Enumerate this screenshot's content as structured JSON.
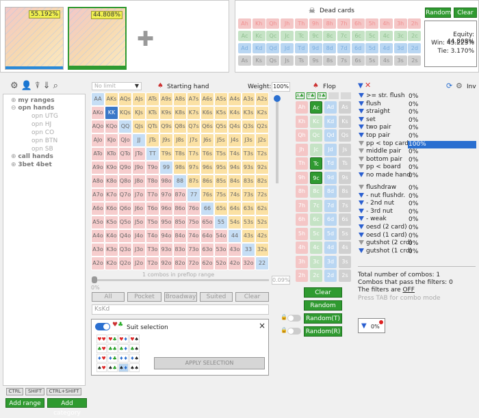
{
  "ranges": [
    {
      "pct": "55.192%",
      "accent": "#2a8ad8"
    },
    {
      "pct": "44.808%",
      "accent": "#2f9a30"
    }
  ],
  "dead_cards": {
    "title": "Dead cards",
    "random": "Random",
    "clear": "Clear",
    "rows": [
      [
        "Ah",
        "Kh",
        "Qh",
        "Jh",
        "Th",
        "9h",
        "8h",
        "7h",
        "6h",
        "5h",
        "4h",
        "3h",
        "2h"
      ],
      [
        "Ac",
        "Kc",
        "Qc",
        "Jc",
        "Tc",
        "9c",
        "8c",
        "7c",
        "6c",
        "5c",
        "4c",
        "3c",
        "2c"
      ],
      [
        "Ad",
        "Kd",
        "Qd",
        "Jd",
        "Td",
        "9d",
        "8d",
        "7d",
        "6d",
        "5d",
        "4d",
        "3d",
        "2d"
      ],
      [
        "As",
        "Ks",
        "Qs",
        "Js",
        "Ts",
        "9s",
        "8s",
        "7s",
        "6s",
        "5s",
        "4s",
        "3s",
        "2s"
      ]
    ]
  },
  "equity": {
    "equity": "Equity: 44.808%",
    "win": "Win: 43.223%",
    "tie": "Tie: 3.170%"
  },
  "limit": "No limit",
  "starting_hand": "Starting hand",
  "weight_label": "Weight:",
  "weight_value": "100%",
  "combos_info": "1 combos in preflop range",
  "slider_value": "0.09%",
  "slider_min": "0%",
  "filter_buttons": [
    "All",
    "Pocket",
    "Broadway",
    "Suited",
    "Clear"
  ],
  "hand_input": "KsKd",
  "suit_selection": {
    "title": "Suit selection",
    "apply": "APPLY SELECTION",
    "close": "×"
  },
  "tree": {
    "my_ranges": "my ranges",
    "opn_hands": "opn hands",
    "utg": "opn UTG",
    "hj": "opn HJ",
    "co": "opn CO",
    "btn": "opn BTN",
    "sb": "opn SB",
    "call_hands": "call hands",
    "bet3": "3bet 4bet"
  },
  "modifier_keys": [
    "CTRL",
    "SHIFT",
    "CTRL+SHIFT"
  ],
  "add_range": "Add range",
  "add_category": "Add category",
  "flop": {
    "title": "Flop",
    "chips": [
      "A♣",
      "T♣",
      "9♣"
    ],
    "cards": [
      [
        "Ah",
        "Ac",
        "Ad",
        "As"
      ],
      [
        "Kh",
        "Kc",
        "Kd",
        "Ks"
      ],
      [
        "Qh",
        "Qc",
        "Qd",
        "Qs"
      ],
      [
        "Jh",
        "Jc",
        "Jd",
        "Js"
      ],
      [
        "Th",
        "Tc",
        "Td",
        "Ts"
      ],
      [
        "9h",
        "9c",
        "9d",
        "9s"
      ],
      [
        "8h",
        "8c",
        "8d",
        "8s"
      ],
      [
        "7h",
        "7c",
        "7d",
        "7s"
      ],
      [
        "6h",
        "6c",
        "6d",
        "6s"
      ],
      [
        "5h",
        "5c",
        "5d",
        "5s"
      ],
      [
        "4h",
        "4c",
        "4d",
        "4s"
      ],
      [
        "3h",
        "3c",
        "3d",
        "3s"
      ],
      [
        "2h",
        "2c",
        "2d",
        "2s"
      ]
    ],
    "clear": "Clear",
    "random": "Random",
    "random_t": "Random(T)",
    "random_r": "Random(R)"
  },
  "inv": "Inv",
  "filters": [
    {
      "label": ">= str. flush",
      "value": "0%",
      "on": true
    },
    {
      "label": "flush",
      "value": "0%",
      "on": true
    },
    {
      "label": "straight",
      "value": "0%",
      "on": true
    },
    {
      "label": "set",
      "value": "0%",
      "on": true
    },
    {
      "label": "two pair",
      "value": "0%",
      "on": true
    },
    {
      "label": "top pair",
      "value": "0%",
      "on": true
    },
    {
      "label": "pp < top card",
      "value": "100%",
      "on": false,
      "hl": true
    },
    {
      "label": "middle pair",
      "value": "0%",
      "on": false
    },
    {
      "label": "bottom pair",
      "value": "0%",
      "on": false
    },
    {
      "label": "pp < board",
      "value": "0%",
      "on": false
    },
    {
      "label": "no made hand",
      "value": "0%",
      "on": true
    },
    {
      "label": "flushdraw",
      "value": "0%",
      "on": false
    },
    {
      "label": "- nut flushdr.",
      "value": "0%",
      "on": true
    },
    {
      "label": "- 2nd nut",
      "value": "0%",
      "on": true
    },
    {
      "label": "- 3rd nut",
      "value": "0%",
      "on": true
    },
    {
      "label": "- weak",
      "value": "0%",
      "on": true
    },
    {
      "label": "oesd (2 card)",
      "value": "0%",
      "on": true
    },
    {
      "label": "oesd (1 card)",
      "value": "0%",
      "on": true
    },
    {
      "label": "gutshot (2 crd)",
      "value": "0%",
      "on": false
    },
    {
      "label": "gutshot (1 crd)",
      "value": "0%",
      "on": true
    }
  ],
  "summary": {
    "total": "Total number of combos: 1",
    "pass": "Combos that pass the filters: 0",
    "filters_prefix": "The filters are ",
    "filters_state": "OFF",
    "hint": "Press TAB for combo mode"
  },
  "badge_value": "0%",
  "matrix_ranks": [
    "A",
    "K",
    "Q",
    "J",
    "T",
    "9",
    "8",
    "7",
    "6",
    "5",
    "4",
    "3",
    "2"
  ],
  "selected_hands": [
    "KK"
  ]
}
